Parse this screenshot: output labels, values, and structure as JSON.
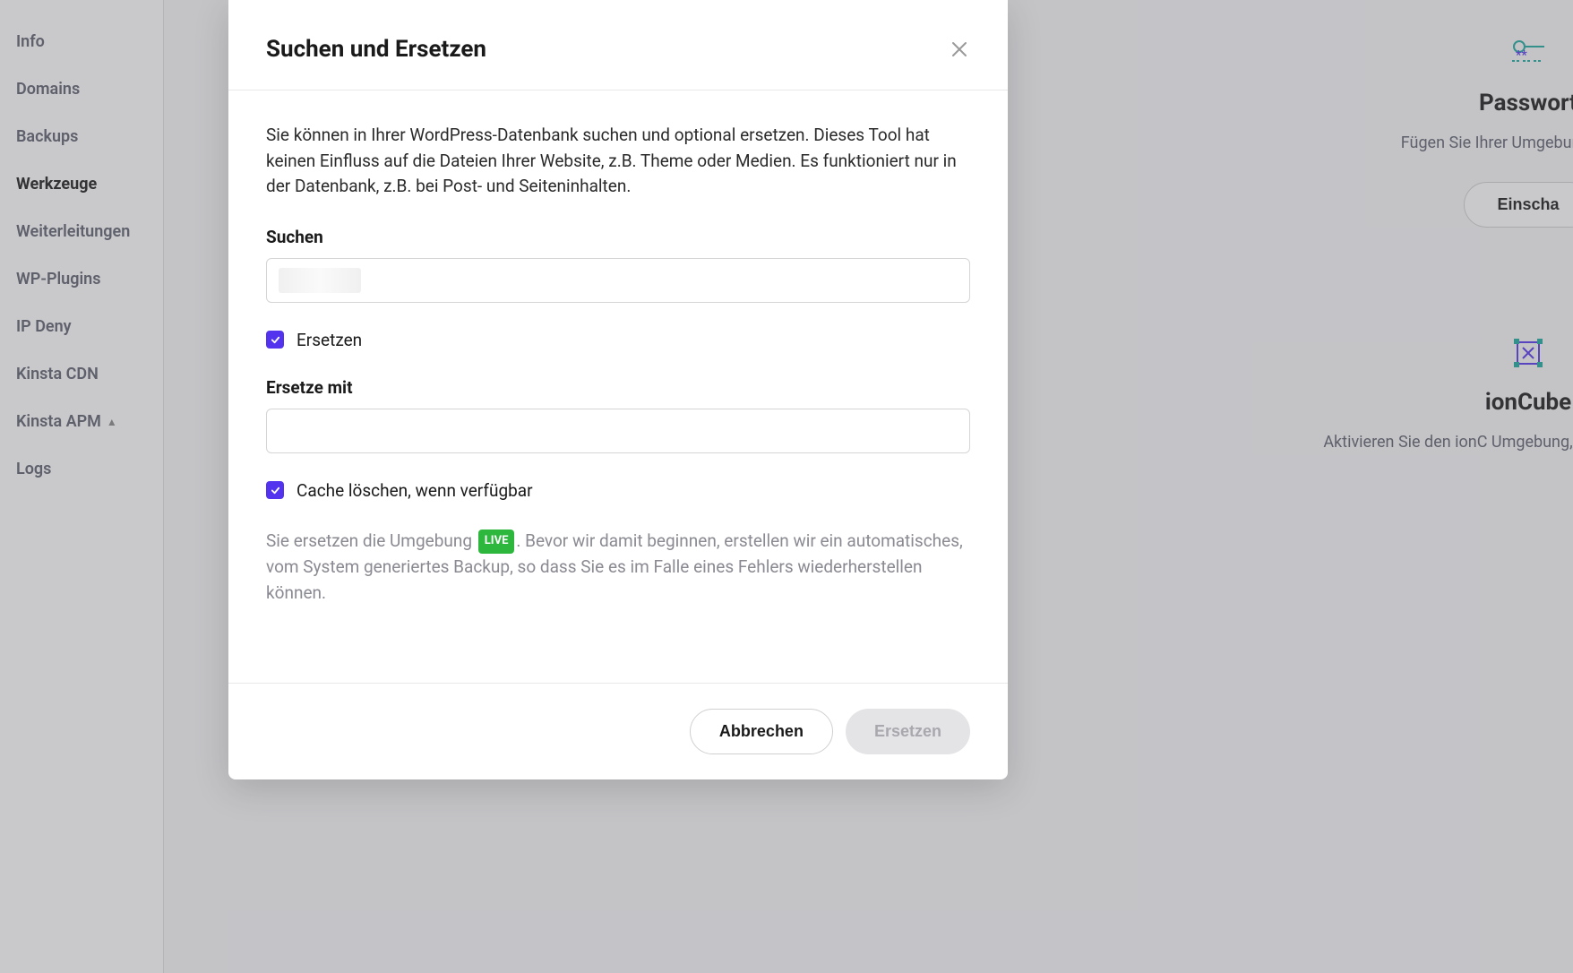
{
  "sidebar": {
    "items": [
      {
        "label": "Info"
      },
      {
        "label": "Domains"
      },
      {
        "label": "Backups"
      },
      {
        "label": "Werkzeuge",
        "active": true
      },
      {
        "label": "Weiterleitungen"
      },
      {
        "label": "WP-Plugins"
      },
      {
        "label": "IP Deny"
      },
      {
        "label": "Kinsta CDN"
      },
      {
        "label": "Kinsta APM",
        "badge": "▲"
      },
      {
        "label": "Logs"
      }
    ]
  },
  "rightPanel": {
    "password": {
      "title": "Passwort",
      "text": "Fügen Sie Ihrer Umgebung Schutz h",
      "button": "Einscha"
    },
    "ioncube": {
      "title": "ionCube",
      "text": "Aktivieren Sie den ionC Umgebung, wenn der C verschleie"
    }
  },
  "modal": {
    "title": "Suchen und Ersetzen",
    "description": "Sie können in Ihrer WordPress-Datenbank suchen und optional ersetzen. Dieses Tool hat keinen Einfluss auf die Dateien Ihrer Website, z.B. Theme oder Medien. Es funktioniert nur in der Datenbank, z.B. bei Post- und Seiteninhalten.",
    "search": {
      "label": "Suchen",
      "value": ""
    },
    "replaceCheckbox": {
      "label": "Ersetzen",
      "checked": true
    },
    "replaceWith": {
      "label": "Ersetze mit",
      "value": ""
    },
    "clearCacheCheckbox": {
      "label": "Cache löschen, wenn verfügbar",
      "checked": true
    },
    "info": {
      "prefix": "Sie ersetzen die Umgebung ",
      "badge": "LIVE",
      "suffix": ". Bevor wir damit beginnen, erstellen wir ein automatisches, vom System generiertes Backup, so dass Sie es im Falle eines Fehlers wiederherstellen können."
    },
    "buttons": {
      "cancel": "Abbrechen",
      "submit": "Ersetzen"
    }
  }
}
